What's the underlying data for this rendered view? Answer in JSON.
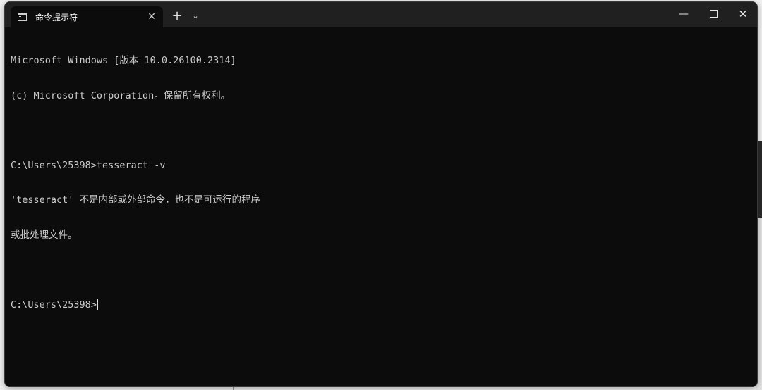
{
  "window": {
    "tab_title": "命令提示符",
    "tab_close": "✕",
    "new_tab": "+",
    "tab_dropdown": "⌄",
    "minimize": "—",
    "close": "✕"
  },
  "terminal": {
    "lines": [
      "Microsoft Windows [版本 10.0.26100.2314]",
      "(c) Microsoft Corporation。保留所有权利。",
      "",
      "C:\\Users\\25398>tesseract -v",
      "'tesseract' 不是内部或外部命令，也不是可运行的程序",
      "或批处理文件。",
      "",
      "C:\\Users\\25398>"
    ]
  },
  "icons": {
    "tab_icon": "terminal-icon",
    "new_tab": "plus-icon",
    "dropdown": "chevron-down-icon",
    "minimize": "minimize-icon",
    "maximize": "maximize-icon",
    "close": "close-icon"
  },
  "colors": {
    "terminal_bg": "#0c0c0c",
    "terminal_text": "#cccccc",
    "titlebar_bg": "#202020"
  }
}
